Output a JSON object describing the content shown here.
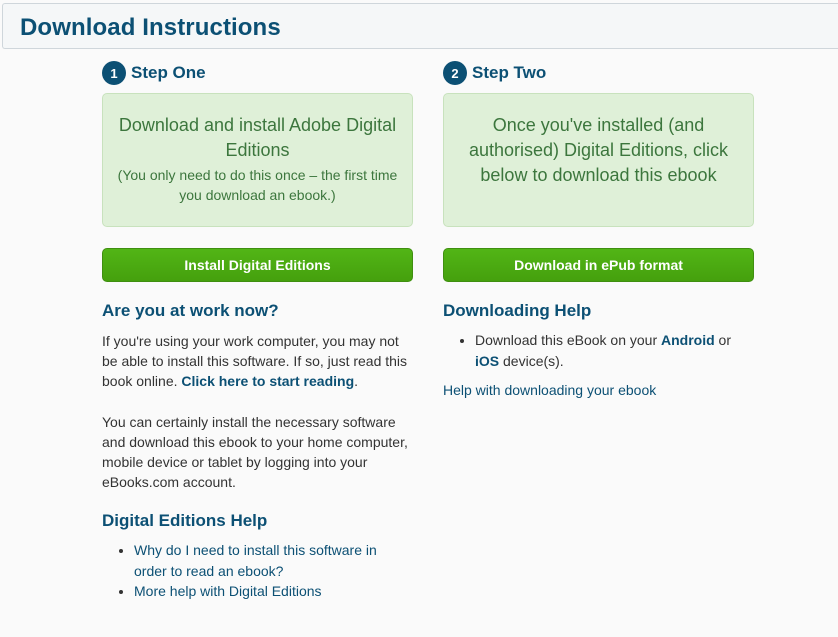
{
  "header": {
    "title": "Download Instructions"
  },
  "step_one": {
    "number": "1",
    "title": "Step One",
    "box_main": "Download and install Adobe Digital Editions",
    "box_note": "(You only need to do this once – the first time you download an ebook.)",
    "button_label": "Install Digital Editions"
  },
  "step_two": {
    "number": "2",
    "title": "Step Two",
    "box_main": "Once you've installed (and authorised) Digital Editions, click below to download this ebook",
    "button_label": "Download in ePub format"
  },
  "work": {
    "heading": "Are you at work now?",
    "para1_text": "If you're using your work computer, you may not be able to install this software. If so, just read this book online. ",
    "para1_link": "Click here to start reading",
    "para1_end": ".",
    "para2": "You can certainly install the necessary software and download this ebook to your home computer, mobile device or tablet by logging into your eBooks.com account."
  },
  "de_help": {
    "heading": "Digital Editions Help",
    "links": [
      "Why do I need to install this software in order to read an ebook?",
      "More help with Digital Editions"
    ]
  },
  "downloading_help": {
    "heading": "Downloading Help",
    "item_prefix": "Download this eBook on your ",
    "android_link": "Android",
    "item_mid": " or ",
    "ios_link": "iOS",
    "item_suffix": " device(s).",
    "help_link": "Help with downloading your ebook"
  },
  "colors": {
    "brand_blue": "#0c5074",
    "button_green": "#4cac12",
    "box_green_bg": "#dff0d8",
    "box_green_text": "#3c763d"
  }
}
